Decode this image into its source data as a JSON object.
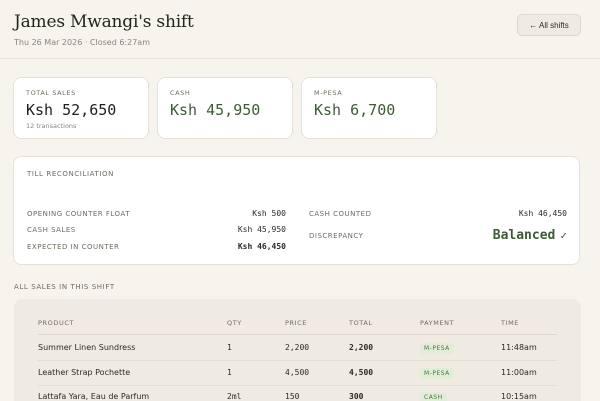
{
  "header": {
    "title": "James Mwangi's shift",
    "subtitle": "Thu 26 Mar 2026 · Closed 6:27am",
    "back_label": "← All shifts"
  },
  "summary": {
    "total_sales": {
      "label": "TOTAL SALES",
      "value": "Ksh 52,650",
      "sub": "12 transactions"
    },
    "cash": {
      "label": "CASH",
      "value": "Ksh 45,950"
    },
    "mpesa": {
      "label": "M-PESA",
      "value": "Ksh 6,700"
    }
  },
  "reconciliation": {
    "title": "TILL RECONCILIATION",
    "opening_float": {
      "label": "OPENING COUNTER FLOAT",
      "value": "Ksh 500"
    },
    "cash_sales": {
      "label": "CASH SALES",
      "value": "Ksh 45,950"
    },
    "expected": {
      "label": "EXPECTED IN COUNTER",
      "value": "Ksh 46,450"
    },
    "cash_counted": {
      "label": "CASH COUNTED",
      "value": "Ksh 46,450"
    },
    "discrepancy": {
      "label": "DISCREPANCY",
      "value": "Balanced",
      "icon": "check-icon"
    }
  },
  "sales": {
    "title": "ALL SALES IN THIS SHIFT",
    "columns": [
      "PRODUCT",
      "QTY",
      "PRICE",
      "TOTAL",
      "PAYMENT",
      "TIME"
    ],
    "rows": [
      {
        "product": "Summer Linen Sundress",
        "qty": "1",
        "price": "2,200",
        "total": "2,200",
        "payment": "M-PESA",
        "time": "11:48am"
      },
      {
        "product": "Leather Strap Pochette",
        "qty": "1",
        "price": "4,500",
        "total": "4,500",
        "payment": "M-PESA",
        "time": "11:00am"
      },
      {
        "product": "Lattafa Yara, Eau de Parfum",
        "qty": "2ml",
        "price": "150",
        "total": "300",
        "payment": "CASH",
        "time": "10:15am"
      }
    ]
  },
  "colors": {
    "background": "#f7f4ee",
    "accent_green": "#3f5a36",
    "badge_bg": "#e3ecd9",
    "badge_text": "#3f7a3a"
  }
}
